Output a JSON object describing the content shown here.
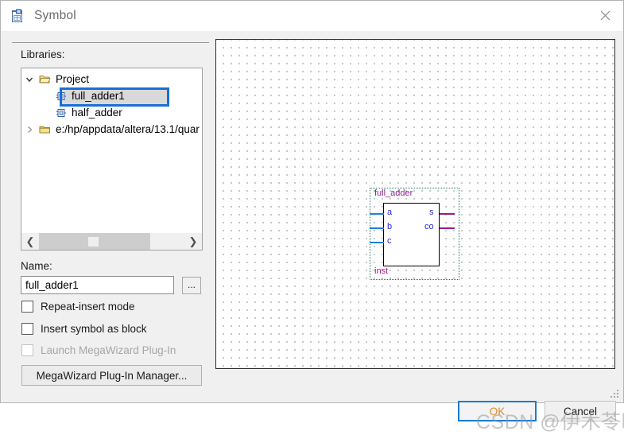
{
  "window": {
    "title": "Symbol",
    "icon": "symbol-document-icon",
    "close_label": "✕"
  },
  "left_panel": {
    "libraries_label": "Libraries:",
    "tree": [
      {
        "label": "Project",
        "icon": "open-folder-icon",
        "arrow": "chevron-down-icon",
        "depth": 0,
        "selected": false
      },
      {
        "label": "full_adder1",
        "icon": "symbol-block-icon",
        "arrow": "",
        "depth": 1,
        "selected": true
      },
      {
        "label": "half_adder",
        "icon": "symbol-block-icon",
        "arrow": "",
        "depth": 1,
        "selected": false
      },
      {
        "label": "e:/hp/appdata/altera/13.1/quar",
        "icon": "closed-folder-icon",
        "arrow": "chevron-right-icon",
        "depth": 0,
        "selected": false
      }
    ],
    "scrollbar": {
      "left_arrow": "❮",
      "right_arrow": "❯"
    },
    "name_label": "Name:",
    "name_value": "full_adder1",
    "name_placeholder": "",
    "browse_label": "...",
    "checkboxes": [
      {
        "label": "Repeat-insert mode",
        "checked": false,
        "disabled": false
      },
      {
        "label": "Insert symbol as block",
        "checked": false,
        "disabled": false
      },
      {
        "label": "Launch MegaWizard Plug-In",
        "checked": false,
        "disabled": true
      }
    ],
    "megawizard_button": "MegaWizard Plug-In Manager..."
  },
  "preview": {
    "symbol_title": "full_adder",
    "instance_name": "inst",
    "input_pins": [
      {
        "name": "a"
      },
      {
        "name": "b"
      },
      {
        "name": "c"
      }
    ],
    "output_pins": [
      {
        "name": "s"
      },
      {
        "name": "co"
      }
    ]
  },
  "footer": {
    "ok_label": "OK",
    "cancel_label": "Cancel"
  },
  "watermark": {
    "text": "CSDN @伊木苓曦"
  },
  "colors": {
    "accent": "#1a7bd4",
    "selection_border": "#1a6fd4",
    "selection_fill": "#d9d9d9",
    "symbol_outline": "#000000",
    "input_pin": "#1f7fe0",
    "output_pin": "#8f1f8f",
    "pin_label": "#2a2ad8",
    "symbol_title": "#8f1f8f",
    "instance_label": "#b0158f",
    "selection_dotted": "#1b7a6e",
    "ok_text": "#d98c2b",
    "window_bg": "#f0f0f0"
  }
}
